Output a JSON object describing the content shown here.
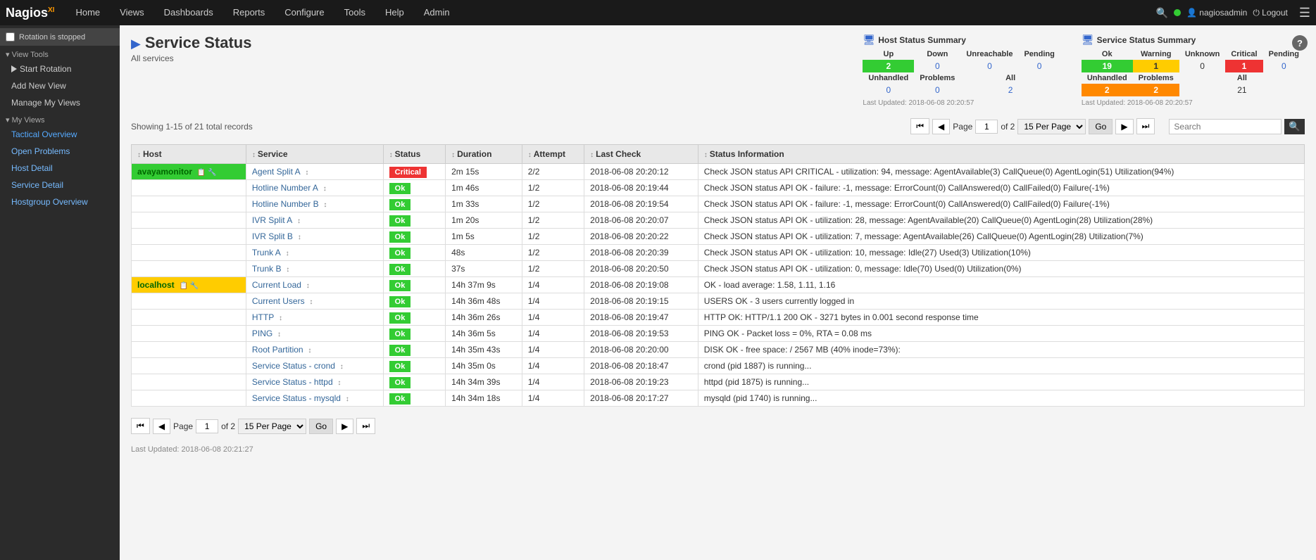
{
  "nav": {
    "logo": "Nagios",
    "logo_sup": "XI",
    "items": [
      "Home",
      "Views",
      "Dashboards",
      "Reports",
      "Configure",
      "Tools",
      "Help",
      "Admin"
    ],
    "user": "nagiosadmin",
    "logout": "Logout"
  },
  "sidebar": {
    "rotation_label": "Rotation is stopped",
    "view_tools_label": "View Tools",
    "start_rotation": "Start Rotation",
    "add_new_view": "Add New View",
    "manage_views": "Manage My Views",
    "my_views_label": "My Views",
    "menu_items": [
      "Tactical Overview",
      "Open Problems",
      "Host Detail",
      "Service Detail",
      "Hostgroup Overview"
    ]
  },
  "page": {
    "title": "Service Status",
    "subtitle": "All services",
    "showing": "Showing 1-15 of 21 total records"
  },
  "pagination": {
    "page_label": "Page",
    "page_value": "1",
    "of_label": "of 2",
    "per_page": "15 Per Page",
    "go_label": "Go"
  },
  "search": {
    "placeholder": "Search"
  },
  "host_summary": {
    "title": "Host Status Summary",
    "headers": [
      "Up",
      "Down",
      "Unreachable",
      "Pending"
    ],
    "row1": [
      "2",
      "0",
      "0",
      "0"
    ],
    "row1_colors": [
      "green",
      "blue",
      "blue",
      "blue"
    ],
    "subheaders": [
      "Unhandled",
      "Problems",
      "All"
    ],
    "row2": [
      "0",
      "0",
      "2"
    ],
    "updated": "Last Updated: 2018-06-08 20:20:57"
  },
  "service_summary": {
    "title": "Service Status Summary",
    "headers": [
      "Ok",
      "Warning",
      "Unknown",
      "Critical",
      "Pending"
    ],
    "row1": [
      "19",
      "1",
      "0",
      "1",
      "0"
    ],
    "row1_colors": [
      "green",
      "yellow",
      "plain",
      "red",
      "blue"
    ],
    "subheaders": [
      "Unhandled",
      "Problems",
      "All"
    ],
    "row2": [
      "2",
      "2",
      "21"
    ],
    "row2_colors": [
      "orange",
      "orange",
      "plain"
    ],
    "updated": "Last Updated: 2018-06-08 20:20:57"
  },
  "table": {
    "headers": [
      "Host",
      "Service",
      "Status",
      "Duration",
      "Attempt",
      "Last Check",
      "Status Information"
    ],
    "rows": [
      {
        "host": "avayamonitor",
        "host_bg": "green",
        "service": "Agent Split A",
        "status": "Critical",
        "status_type": "critical",
        "duration": "2m 15s",
        "attempt": "2/2",
        "last_check": "2018-06-08 20:20:12",
        "info": "Check JSON status API CRITICAL - utilization: 94, message: AgentAvailable(3) CallQueue(0) AgentLogin(51) Utilization(94%)"
      },
      {
        "host": "",
        "host_bg": "",
        "service": "Hotline Number A",
        "status": "Ok",
        "status_type": "ok",
        "duration": "1m 46s",
        "attempt": "1/2",
        "last_check": "2018-06-08 20:19:44",
        "info": "Check JSON status API OK - failure: -1, message: ErrorCount(0) CallAnswered(0) CallFailed(0) Failure(-1%)"
      },
      {
        "host": "",
        "host_bg": "",
        "service": "Hotline Number B",
        "status": "Ok",
        "status_type": "ok",
        "duration": "1m 33s",
        "attempt": "1/2",
        "last_check": "2018-06-08 20:19:54",
        "info": "Check JSON status API OK - failure: -1, message: ErrorCount(0) CallAnswered(0) CallFailed(0) Failure(-1%)"
      },
      {
        "host": "",
        "host_bg": "",
        "service": "IVR Split A",
        "status": "Ok",
        "status_type": "ok",
        "duration": "1m 20s",
        "attempt": "1/2",
        "last_check": "2018-06-08 20:20:07",
        "info": "Check JSON status API OK - utilization: 28, message: AgentAvailable(20) CallQueue(0) AgentLogin(28) Utilization(28%)"
      },
      {
        "host": "",
        "host_bg": "",
        "service": "IVR Split B",
        "status": "Ok",
        "status_type": "ok",
        "duration": "1m 5s",
        "attempt": "1/2",
        "last_check": "2018-06-08 20:20:22",
        "info": "Check JSON status API OK - utilization: 7, message: AgentAvailable(26) CallQueue(0) AgentLogin(28) Utilization(7%)"
      },
      {
        "host": "",
        "host_bg": "",
        "service": "Trunk A",
        "status": "Ok",
        "status_type": "ok",
        "duration": "48s",
        "attempt": "1/2",
        "last_check": "2018-06-08 20:20:39",
        "info": "Check JSON status API OK - utilization: 10, message: Idle(27) Used(3) Utilization(10%)"
      },
      {
        "host": "",
        "host_bg": "",
        "service": "Trunk B",
        "status": "Ok",
        "status_type": "ok",
        "duration": "37s",
        "attempt": "1/2",
        "last_check": "2018-06-08 20:20:50",
        "info": "Check JSON status API OK - utilization: 0, message: Idle(70) Used(0) Utilization(0%)"
      },
      {
        "host": "localhost",
        "host_bg": "yellow",
        "service": "Current Load",
        "status": "Ok",
        "status_type": "ok",
        "duration": "14h 37m 9s",
        "attempt": "1/4",
        "last_check": "2018-06-08 20:19:08",
        "info": "OK - load average: 1.58, 1.11, 1.16"
      },
      {
        "host": "",
        "host_bg": "",
        "service": "Current Users",
        "status": "Ok",
        "status_type": "ok",
        "duration": "14h 36m 48s",
        "attempt": "1/4",
        "last_check": "2018-06-08 20:19:15",
        "info": "USERS OK - 3 users currently logged in"
      },
      {
        "host": "",
        "host_bg": "",
        "service": "HTTP",
        "status": "Ok",
        "status_type": "ok",
        "duration": "14h 36m 26s",
        "attempt": "1/4",
        "last_check": "2018-06-08 20:19:47",
        "info": "HTTP OK: HTTP/1.1 200 OK - 3271 bytes in 0.001 second response time"
      },
      {
        "host": "",
        "host_bg": "",
        "service": "PING",
        "status": "Ok",
        "status_type": "ok",
        "duration": "14h 36m 5s",
        "attempt": "1/4",
        "last_check": "2018-06-08 20:19:53",
        "info": "PING OK - Packet loss = 0%, RTA = 0.08 ms"
      },
      {
        "host": "",
        "host_bg": "",
        "service": "Root Partition",
        "status": "Ok",
        "status_type": "ok",
        "duration": "14h 35m 43s",
        "attempt": "1/4",
        "last_check": "2018-06-08 20:20:00",
        "info": "DISK OK - free space: / 2567 MB (40% inode=73%):"
      },
      {
        "host": "",
        "host_bg": "",
        "service": "Service Status - crond",
        "status": "Ok",
        "status_type": "ok",
        "duration": "14h 35m 0s",
        "attempt": "1/4",
        "last_check": "2018-06-08 20:18:47",
        "info": "crond (pid 1887) is running..."
      },
      {
        "host": "",
        "host_bg": "",
        "service": "Service Status - httpd",
        "status": "Ok",
        "status_type": "ok",
        "duration": "14h 34m 39s",
        "attempt": "1/4",
        "last_check": "2018-06-08 20:19:23",
        "info": "httpd (pid 1875) is running..."
      },
      {
        "host": "",
        "host_bg": "",
        "service": "Service Status - mysqld",
        "status": "Ok",
        "status_type": "ok",
        "duration": "14h 34m 18s",
        "attempt": "1/4",
        "last_check": "2018-06-08 20:17:27",
        "info": "mysqld (pid 1740) is running..."
      }
    ]
  },
  "footer": {
    "updated": "Last Updated: 2018-06-08 20:21:27"
  },
  "colors": {
    "green": "#33cc33",
    "red": "#ee3333",
    "yellow": "#ffcc00",
    "orange": "#ff8800",
    "blue": "#3366cc"
  }
}
